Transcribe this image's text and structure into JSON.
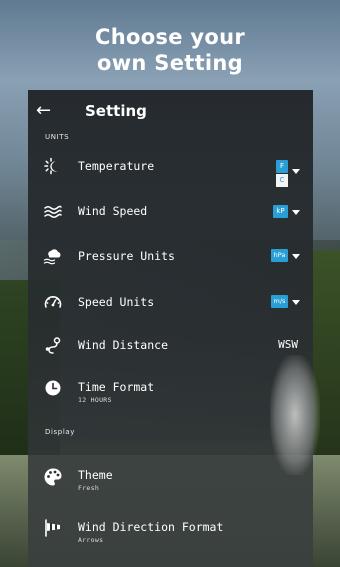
{
  "headline": {
    "line1": "Choose your",
    "line2": "own Setting"
  },
  "header": {
    "title": "Setting"
  },
  "sections": {
    "units": "UNITS",
    "display": "Display"
  },
  "rows": {
    "temperature": {
      "label": "Temperature",
      "selected": "F",
      "alternate": "C"
    },
    "wind_speed": {
      "label": "Wind Speed",
      "selected": "kP"
    },
    "pressure_units": {
      "label": "Pressure Units",
      "selected": "hPa"
    },
    "speed_units": {
      "label": "Speed Units",
      "selected": "m/s"
    },
    "wind_distance": {
      "label": "Wind Distance",
      "value": "WSW"
    },
    "time_format": {
      "label": "Time Format",
      "sub": "12 HOURS"
    },
    "theme": {
      "label": "Theme",
      "sub": "Fresh"
    },
    "wind_direction_format": {
      "label": "Wind Direction Format",
      "sub": "Arrows"
    }
  },
  "colors": {
    "accent": "#2a9fd6",
    "panel": "#24282c"
  },
  "icons": {
    "back": "arrow-left-icon",
    "temperature": "sun-moon-icon",
    "wind_speed": "wind-waves-icon",
    "pressure": "cloud-pressure-icon",
    "speed": "speedometer-icon",
    "distance": "route-pin-icon",
    "time": "clock-icon",
    "theme": "palette-icon",
    "direction": "windsock-icon"
  }
}
